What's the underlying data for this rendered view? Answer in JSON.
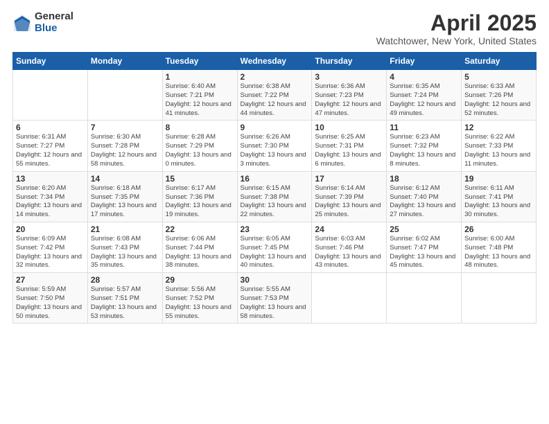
{
  "logo": {
    "general": "General",
    "blue": "Blue"
  },
  "title": "April 2025",
  "location": "Watchtower, New York, United States",
  "headers": [
    "Sunday",
    "Monday",
    "Tuesday",
    "Wednesday",
    "Thursday",
    "Friday",
    "Saturday"
  ],
  "weeks": [
    [
      {
        "day": "",
        "sunrise": "",
        "sunset": "",
        "daylight": ""
      },
      {
        "day": "",
        "sunrise": "",
        "sunset": "",
        "daylight": ""
      },
      {
        "day": "1",
        "sunrise": "Sunrise: 6:40 AM",
        "sunset": "Sunset: 7:21 PM",
        "daylight": "Daylight: 12 hours and 41 minutes."
      },
      {
        "day": "2",
        "sunrise": "Sunrise: 6:38 AM",
        "sunset": "Sunset: 7:22 PM",
        "daylight": "Daylight: 12 hours and 44 minutes."
      },
      {
        "day": "3",
        "sunrise": "Sunrise: 6:36 AM",
        "sunset": "Sunset: 7:23 PM",
        "daylight": "Daylight: 12 hours and 47 minutes."
      },
      {
        "day": "4",
        "sunrise": "Sunrise: 6:35 AM",
        "sunset": "Sunset: 7:24 PM",
        "daylight": "Daylight: 12 hours and 49 minutes."
      },
      {
        "day": "5",
        "sunrise": "Sunrise: 6:33 AM",
        "sunset": "Sunset: 7:26 PM",
        "daylight": "Daylight: 12 hours and 52 minutes."
      }
    ],
    [
      {
        "day": "6",
        "sunrise": "Sunrise: 6:31 AM",
        "sunset": "Sunset: 7:27 PM",
        "daylight": "Daylight: 12 hours and 55 minutes."
      },
      {
        "day": "7",
        "sunrise": "Sunrise: 6:30 AM",
        "sunset": "Sunset: 7:28 PM",
        "daylight": "Daylight: 12 hours and 58 minutes."
      },
      {
        "day": "8",
        "sunrise": "Sunrise: 6:28 AM",
        "sunset": "Sunset: 7:29 PM",
        "daylight": "Daylight: 13 hours and 0 minutes."
      },
      {
        "day": "9",
        "sunrise": "Sunrise: 6:26 AM",
        "sunset": "Sunset: 7:30 PM",
        "daylight": "Daylight: 13 hours and 3 minutes."
      },
      {
        "day": "10",
        "sunrise": "Sunrise: 6:25 AM",
        "sunset": "Sunset: 7:31 PM",
        "daylight": "Daylight: 13 hours and 6 minutes."
      },
      {
        "day": "11",
        "sunrise": "Sunrise: 6:23 AM",
        "sunset": "Sunset: 7:32 PM",
        "daylight": "Daylight: 13 hours and 8 minutes."
      },
      {
        "day": "12",
        "sunrise": "Sunrise: 6:22 AM",
        "sunset": "Sunset: 7:33 PM",
        "daylight": "Daylight: 13 hours and 11 minutes."
      }
    ],
    [
      {
        "day": "13",
        "sunrise": "Sunrise: 6:20 AM",
        "sunset": "Sunset: 7:34 PM",
        "daylight": "Daylight: 13 hours and 14 minutes."
      },
      {
        "day": "14",
        "sunrise": "Sunrise: 6:18 AM",
        "sunset": "Sunset: 7:35 PM",
        "daylight": "Daylight: 13 hours and 17 minutes."
      },
      {
        "day": "15",
        "sunrise": "Sunrise: 6:17 AM",
        "sunset": "Sunset: 7:36 PM",
        "daylight": "Daylight: 13 hours and 19 minutes."
      },
      {
        "day": "16",
        "sunrise": "Sunrise: 6:15 AM",
        "sunset": "Sunset: 7:38 PM",
        "daylight": "Daylight: 13 hours and 22 minutes."
      },
      {
        "day": "17",
        "sunrise": "Sunrise: 6:14 AM",
        "sunset": "Sunset: 7:39 PM",
        "daylight": "Daylight: 13 hours and 25 minutes."
      },
      {
        "day": "18",
        "sunrise": "Sunrise: 6:12 AM",
        "sunset": "Sunset: 7:40 PM",
        "daylight": "Daylight: 13 hours and 27 minutes."
      },
      {
        "day": "19",
        "sunrise": "Sunrise: 6:11 AM",
        "sunset": "Sunset: 7:41 PM",
        "daylight": "Daylight: 13 hours and 30 minutes."
      }
    ],
    [
      {
        "day": "20",
        "sunrise": "Sunrise: 6:09 AM",
        "sunset": "Sunset: 7:42 PM",
        "daylight": "Daylight: 13 hours and 32 minutes."
      },
      {
        "day": "21",
        "sunrise": "Sunrise: 6:08 AM",
        "sunset": "Sunset: 7:43 PM",
        "daylight": "Daylight: 13 hours and 35 minutes."
      },
      {
        "day": "22",
        "sunrise": "Sunrise: 6:06 AM",
        "sunset": "Sunset: 7:44 PM",
        "daylight": "Daylight: 13 hours and 38 minutes."
      },
      {
        "day": "23",
        "sunrise": "Sunrise: 6:05 AM",
        "sunset": "Sunset: 7:45 PM",
        "daylight": "Daylight: 13 hours and 40 minutes."
      },
      {
        "day": "24",
        "sunrise": "Sunrise: 6:03 AM",
        "sunset": "Sunset: 7:46 PM",
        "daylight": "Daylight: 13 hours and 43 minutes."
      },
      {
        "day": "25",
        "sunrise": "Sunrise: 6:02 AM",
        "sunset": "Sunset: 7:47 PM",
        "daylight": "Daylight: 13 hours and 45 minutes."
      },
      {
        "day": "26",
        "sunrise": "Sunrise: 6:00 AM",
        "sunset": "Sunset: 7:48 PM",
        "daylight": "Daylight: 13 hours and 48 minutes."
      }
    ],
    [
      {
        "day": "27",
        "sunrise": "Sunrise: 5:59 AM",
        "sunset": "Sunset: 7:50 PM",
        "daylight": "Daylight: 13 hours and 50 minutes."
      },
      {
        "day": "28",
        "sunrise": "Sunrise: 5:57 AM",
        "sunset": "Sunset: 7:51 PM",
        "daylight": "Daylight: 13 hours and 53 minutes."
      },
      {
        "day": "29",
        "sunrise": "Sunrise: 5:56 AM",
        "sunset": "Sunset: 7:52 PM",
        "daylight": "Daylight: 13 hours and 55 minutes."
      },
      {
        "day": "30",
        "sunrise": "Sunrise: 5:55 AM",
        "sunset": "Sunset: 7:53 PM",
        "daylight": "Daylight: 13 hours and 58 minutes."
      },
      {
        "day": "",
        "sunrise": "",
        "sunset": "",
        "daylight": ""
      },
      {
        "day": "",
        "sunrise": "",
        "sunset": "",
        "daylight": ""
      },
      {
        "day": "",
        "sunrise": "",
        "sunset": "",
        "daylight": ""
      }
    ]
  ]
}
